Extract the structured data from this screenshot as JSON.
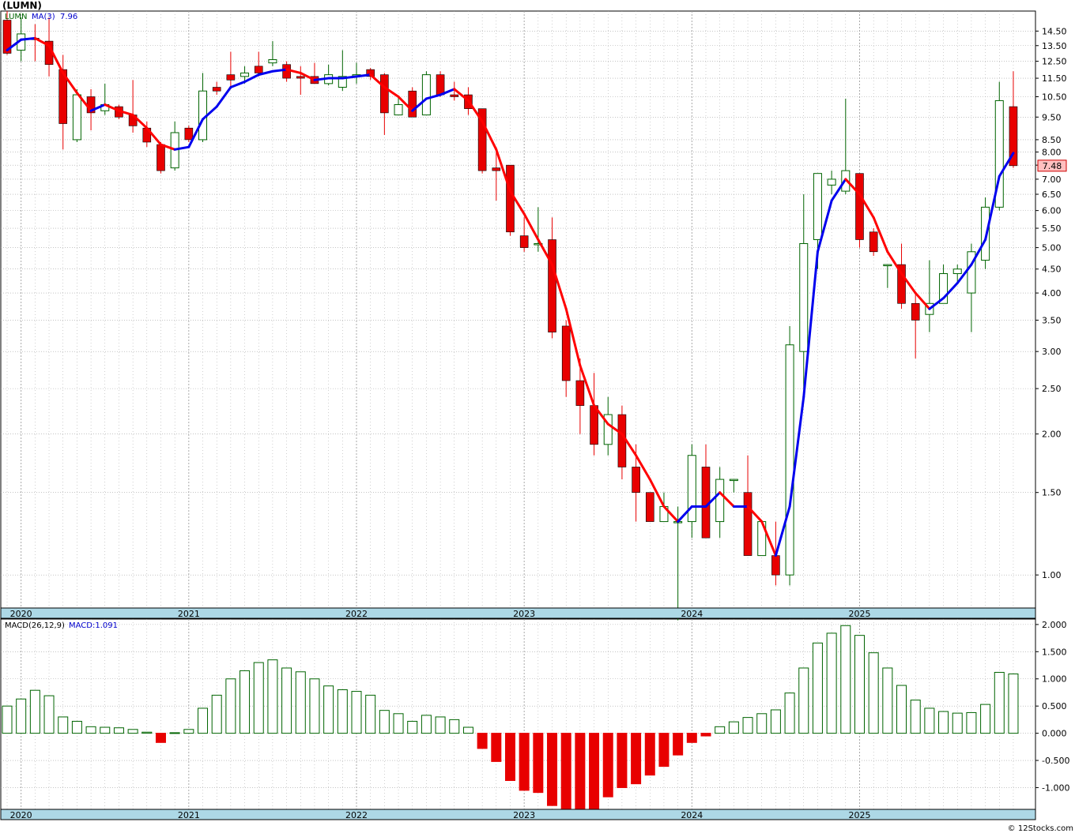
{
  "header": {
    "symbol": "(LUMN)",
    "watermark": "© 12Stocks.com"
  },
  "price_panel": {
    "series_label": "LUMN",
    "ma_label": "MA(3)",
    "ma_value": "7.96",
    "last_price": "7.48"
  },
  "macd_panel": {
    "label": "MACD(26,12,9)",
    "value_label": "MACD:1.091"
  },
  "colors": {
    "up": "#006400",
    "down": "#e80000",
    "ma_up": "#0000ee",
    "ma_down": "#ff0000",
    "axis_band": "#add8e6",
    "grid": "#a0a0a0",
    "price_tag": "#ffc0c0"
  },
  "chart_data": [
    {
      "type": "candlestick",
      "title": "(LUMN)",
      "scale": "log",
      "ylim": [
        0.85,
        16.0
      ],
      "yticks": [
        "1.00",
        "1.50",
        "2.00",
        "2.50",
        "3.00",
        "3.50",
        "4.00",
        "4.50",
        "5.00",
        "5.50",
        "6.00",
        "6.50",
        "7.00",
        "7.50",
        "8.00",
        "8.50",
        "9.50",
        "10.50",
        "11.50",
        "12.50",
        "13.50",
        "14.50"
      ],
      "year_labels": [
        "2020",
        "2021",
        "2022",
        "2023",
        "2024",
        "2025"
      ],
      "year_start_index": [
        1,
        13,
        25,
        37,
        49,
        61
      ],
      "grid": true,
      "ohlc": [
        [
          15.3,
          16.0,
          12.9,
          13.0
        ],
        [
          13.2,
          15.5,
          12.5,
          14.3
        ],
        [
          14.0,
          15.0,
          12.5,
          13.9
        ],
        [
          13.8,
          15.5,
          11.6,
          12.3
        ],
        [
          12.0,
          12.9,
          8.1,
          9.2
        ],
        [
          8.5,
          10.9,
          8.4,
          10.6
        ],
        [
          10.5,
          10.9,
          8.9,
          9.7
        ],
        [
          9.8,
          11.2,
          9.6,
          10.1
        ],
        [
          10.0,
          10.1,
          9.4,
          9.5
        ],
        [
          9.6,
          11.4,
          8.8,
          9.1
        ],
        [
          9.0,
          9.3,
          8.2,
          8.4
        ],
        [
          8.3,
          8.4,
          7.2,
          7.3
        ],
        [
          7.4,
          9.3,
          7.3,
          8.8
        ],
        [
          9.0,
          9.1,
          8.4,
          8.5
        ],
        [
          8.5,
          11.8,
          8.4,
          10.8
        ],
        [
          11.0,
          11.3,
          10.6,
          10.8
        ],
        [
          11.7,
          13.1,
          10.9,
          11.4
        ],
        [
          11.6,
          12.2,
          11.2,
          11.8
        ],
        [
          12.2,
          13.1,
          11.6,
          11.8
        ],
        [
          12.4,
          13.8,
          12.2,
          12.6
        ],
        [
          12.3,
          12.5,
          11.3,
          11.5
        ],
        [
          11.6,
          12.2,
          10.6,
          11.5
        ],
        [
          11.6,
          12.4,
          11.2,
          11.2
        ],
        [
          11.2,
          12.3,
          11.1,
          11.7
        ],
        [
          11.0,
          13.2,
          10.8,
          11.6
        ],
        [
          11.7,
          12.4,
          11.2,
          11.7
        ],
        [
          12.0,
          12.1,
          11.4,
          11.6
        ],
        [
          11.7,
          11.8,
          8.7,
          9.7
        ],
        [
          9.6,
          10.5,
          9.6,
          10.1
        ],
        [
          10.8,
          11.0,
          9.5,
          9.5
        ],
        [
          9.6,
          11.9,
          9.6,
          11.7
        ],
        [
          11.7,
          11.9,
          10.5,
          10.6
        ],
        [
          10.6,
          11.3,
          10.3,
          10.5
        ],
        [
          10.6,
          11.0,
          9.6,
          9.9
        ],
        [
          9.9,
          9.9,
          7.2,
          7.3
        ],
        [
          7.4,
          8.2,
          6.3,
          7.3
        ],
        [
          7.5,
          7.5,
          5.3,
          5.4
        ],
        [
          5.3,
          5.8,
          4.9,
          5.0
        ],
        [
          5.1,
          6.1,
          4.9,
          5.1
        ],
        [
          5.2,
          5.8,
          3.2,
          3.3
        ],
        [
          3.4,
          3.5,
          2.4,
          2.6
        ],
        [
          2.6,
          2.9,
          2.0,
          2.3
        ],
        [
          2.3,
          2.7,
          1.8,
          1.9
        ],
        [
          1.9,
          2.4,
          1.8,
          2.2
        ],
        [
          2.2,
          2.3,
          1.6,
          1.7
        ],
        [
          1.7,
          1.9,
          1.3,
          1.5
        ],
        [
          1.5,
          1.5,
          1.3,
          1.3
        ],
        [
          1.3,
          1.5,
          1.3,
          1.4
        ],
        [
          1.3,
          1.4,
          0.8,
          1.3
        ],
        [
          1.3,
          1.9,
          1.2,
          1.8
        ],
        [
          1.7,
          1.9,
          1.2,
          1.2
        ],
        [
          1.3,
          1.7,
          1.2,
          1.6
        ],
        [
          1.6,
          1.6,
          1.5,
          1.6
        ],
        [
          1.5,
          1.8,
          1.1,
          1.1
        ],
        [
          1.1,
          1.3,
          1.1,
          1.3
        ],
        [
          1.1,
          1.3,
          0.95,
          1.0
        ],
        [
          1.0,
          3.4,
          0.95,
          3.1
        ],
        [
          3.0,
          6.5,
          2.5,
          5.1
        ],
        [
          5.2,
          7.2,
          4.5,
          7.2
        ],
        [
          6.8,
          7.3,
          6.5,
          7.0
        ],
        [
          6.6,
          10.4,
          6.5,
          7.3
        ],
        [
          7.2,
          7.2,
          5.0,
          5.2
        ],
        [
          5.4,
          5.5,
          4.8,
          4.9
        ],
        [
          4.6,
          4.6,
          4.1,
          4.6
        ],
        [
          4.6,
          5.1,
          3.7,
          3.8
        ],
        [
          3.8,
          4.0,
          2.9,
          3.5
        ],
        [
          3.6,
          4.7,
          3.3,
          3.8
        ],
        [
          3.8,
          4.6,
          3.8,
          4.4
        ],
        [
          4.4,
          4.6,
          4.2,
          4.5
        ],
        [
          4.0,
          5.1,
          3.3,
          4.9
        ],
        [
          4.7,
          6.4,
          4.5,
          6.1
        ],
        [
          6.1,
          11.3,
          6.0,
          10.3
        ],
        [
          10.0,
          11.9,
          7.4,
          7.48
        ]
      ],
      "ma3": [
        13.2,
        13.9,
        14.0,
        13.5,
        11.8,
        10.7,
        9.8,
        10.1,
        9.8,
        9.6,
        9.0,
        8.3,
        8.1,
        8.2,
        9.4,
        10.0,
        11.0,
        11.3,
        11.7,
        11.9,
        12.0,
        11.8,
        11.4,
        11.5,
        11.5,
        11.6,
        11.7,
        11.0,
        10.5,
        9.8,
        10.4,
        10.6,
        10.9,
        10.3,
        9.3,
        8.1,
        6.6,
        5.9,
        5.2,
        4.6,
        3.7,
        2.8,
        2.3,
        2.1,
        2.0,
        1.8,
        1.6,
        1.4,
        1.3,
        1.4,
        1.4,
        1.5,
        1.4,
        1.4,
        1.3,
        1.1,
        1.4,
        2.4,
        4.9,
        6.3,
        7.0,
        6.5,
        5.8,
        4.9,
        4.4,
        4.0,
        3.7,
        3.9,
        4.2,
        4.6,
        5.2,
        7.1,
        7.96
      ]
    },
    {
      "type": "bar",
      "title": "MACD(26,12,9)",
      "ylim": [
        -1.4,
        2.1
      ],
      "yticks": [
        "-1.000",
        "-0.500",
        "0.000",
        "0.500",
        "1.000",
        "1.500",
        "2.000"
      ],
      "values": [
        0.5,
        0.63,
        0.79,
        0.69,
        0.3,
        0.22,
        0.12,
        0.11,
        0.1,
        0.07,
        0.02,
        -0.17,
        0.01,
        0.07,
        0.46,
        0.7,
        1.0,
        1.15,
        1.3,
        1.35,
        1.2,
        1.13,
        1.0,
        0.87,
        0.8,
        0.77,
        0.7,
        0.42,
        0.36,
        0.22,
        0.33,
        0.3,
        0.25,
        0.11,
        -0.28,
        -0.52,
        -0.87,
        -1.05,
        -1.09,
        -1.33,
        -1.42,
        -1.4,
        -1.4,
        -1.17,
        -1.0,
        -0.93,
        -0.77,
        -0.61,
        -0.4,
        -0.17,
        -0.05,
        0.12,
        0.21,
        0.29,
        0.36,
        0.43,
        0.74,
        1.2,
        1.66,
        1.84,
        1.98,
        1.8,
        1.48,
        1.2,
        0.88,
        0.61,
        0.46,
        0.4,
        0.37,
        0.38,
        0.53,
        1.12,
        1.091
      ]
    }
  ]
}
